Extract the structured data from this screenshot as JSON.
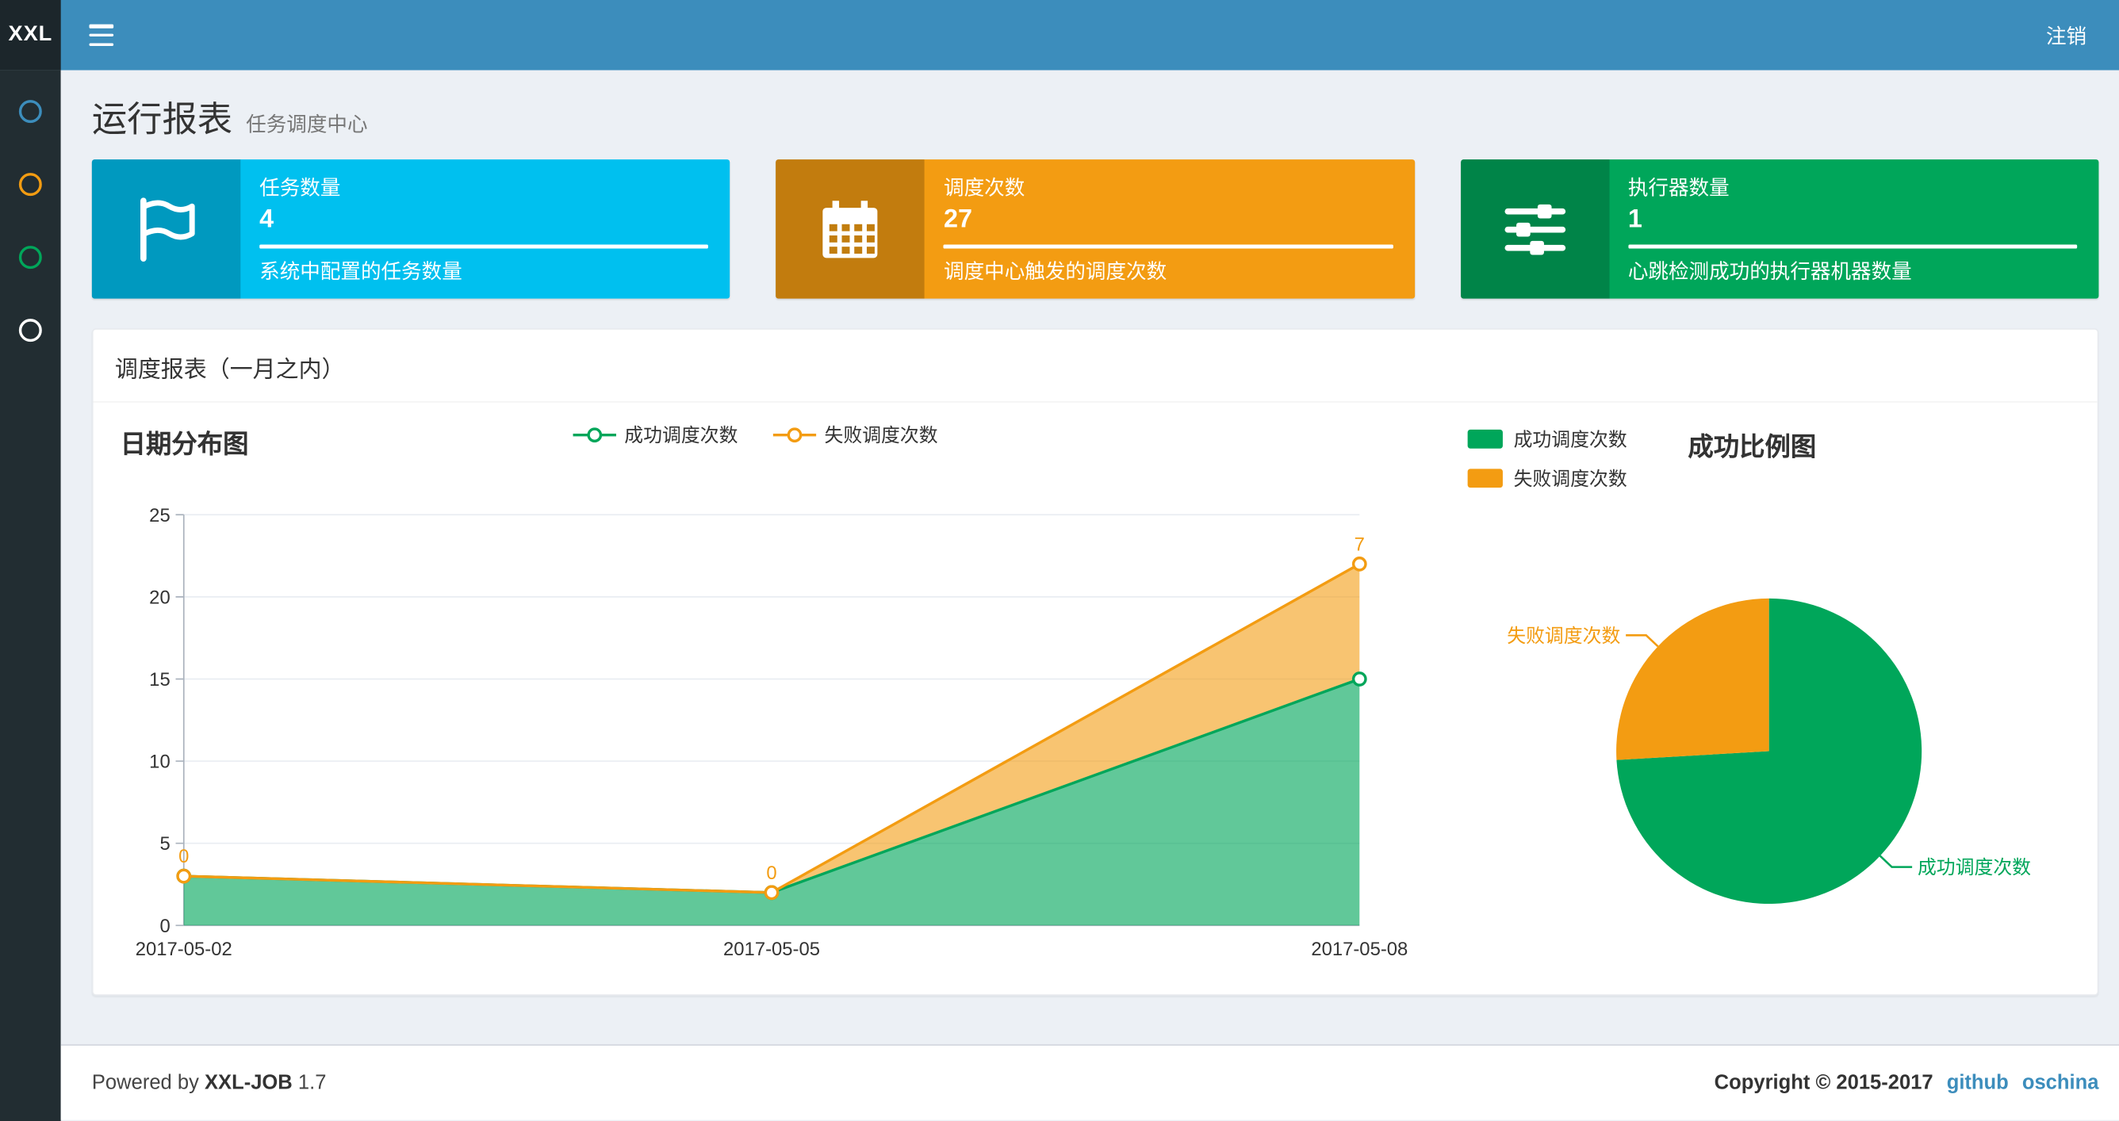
{
  "navbar": {
    "logo": "XXL",
    "logout_label": "注销"
  },
  "sidebar": {
    "items": [
      {
        "name": "menu-item-1",
        "color": "#3c8dbc"
      },
      {
        "name": "menu-item-2",
        "color": "#f39c12"
      },
      {
        "name": "menu-item-3",
        "color": "#00a65a"
      },
      {
        "name": "menu-item-4",
        "color": "#ffffff"
      }
    ]
  },
  "page_header": {
    "title": "运行报表",
    "subtitle": "任务调度中心"
  },
  "info_boxes": [
    {
      "label": "任务数量",
      "value": "4",
      "description": "系统中配置的任务数量",
      "color": "#00c0ef",
      "icon": "flag-icon"
    },
    {
      "label": "调度次数",
      "value": "27",
      "description": "调度中心触发的调度次数",
      "color": "#f39c12",
      "icon": "calendar-icon"
    },
    {
      "label": "执行器数量",
      "value": "1",
      "description": "心跳检测成功的执行器机器数量",
      "color": "#00a65a",
      "icon": "sliders-icon"
    }
  ],
  "panel": {
    "title": "调度报表（一月之内）"
  },
  "chart_data": [
    {
      "type": "area",
      "title": "日期分布图",
      "x": [
        "2017-05-02",
        "2017-05-05",
        "2017-05-08"
      ],
      "stacked": true,
      "ylim": [
        0,
        25
      ],
      "yticks": [
        0,
        5,
        10,
        15,
        20,
        25
      ],
      "grid": true,
      "legend_position": "top-center",
      "series": [
        {
          "name": "成功调度次数",
          "values": [
            3,
            2,
            15
          ],
          "color": "#00a65a",
          "fill": "rgba(0,166,90,0.62)",
          "show_labels": false
        },
        {
          "name": "失败调度次数",
          "values": [
            0,
            0,
            7
          ],
          "color": "#f39c12",
          "fill": "rgba(243,156,18,0.6)",
          "show_labels": true
        }
      ]
    },
    {
      "type": "pie",
      "title": "成功比例图",
      "legend_position": "top-left",
      "slices": [
        {
          "label": "成功调度次数",
          "value": 20,
          "color": "#00a65a"
        },
        {
          "label": "失败调度次数",
          "value": 7,
          "color": "#f39c12"
        }
      ]
    }
  ],
  "footer": {
    "powered_prefix": "Powered by",
    "product": "XXL-JOB",
    "version": "1.7",
    "copyright": "Copyright © 2015-2017",
    "links": [
      {
        "label": "github"
      },
      {
        "label": "oschina"
      }
    ]
  }
}
